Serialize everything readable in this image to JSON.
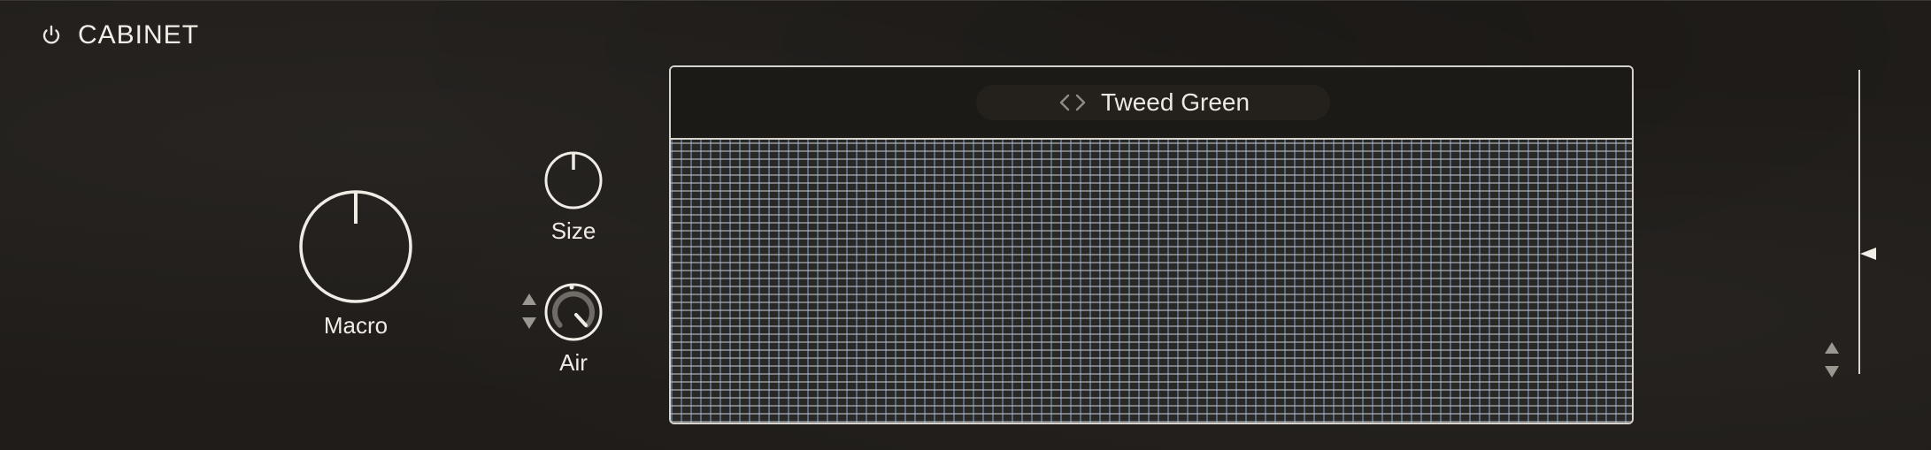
{
  "header": {
    "title": "CABINET",
    "power_icon": "power-icon"
  },
  "knobs": {
    "macro": {
      "label": "Macro",
      "value": 0.5
    },
    "size": {
      "label": "Size",
      "value": 0.5
    },
    "air": {
      "label": "Air",
      "value": 0.85
    }
  },
  "cabinet": {
    "preset_name": "Tweed Green",
    "nav_icon": "chevron-left-right-icon"
  },
  "level": {
    "value": 0.42
  },
  "colors": {
    "background": "#1f1c19",
    "foreground": "#f1ede7",
    "grille_horizontal": "#bec3cd",
    "grille_vertical": "#7da0cd"
  }
}
